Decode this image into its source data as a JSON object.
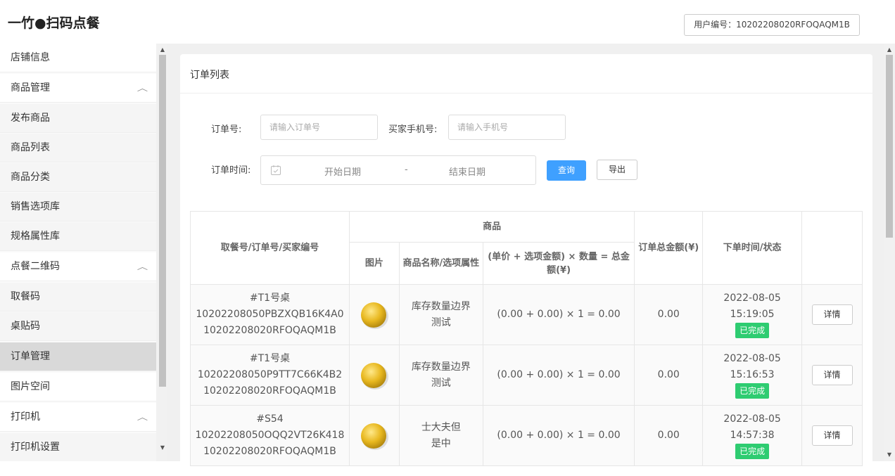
{
  "header": {
    "logo": "一竹●扫码点餐",
    "user_id": "用户编号：10202208020RFOQAQM1B"
  },
  "sidebar": {
    "items": [
      {
        "label": "店铺信息"
      },
      {
        "label": "商品管理"
      },
      {
        "label": "发布商品"
      },
      {
        "label": "商品列表"
      },
      {
        "label": "商品分类"
      },
      {
        "label": "销售选项库"
      },
      {
        "label": "规格属性库"
      },
      {
        "label": "点餐二维码"
      },
      {
        "label": "取餐码"
      },
      {
        "label": "桌贴码"
      },
      {
        "label": "订单管理"
      },
      {
        "label": "图片空间"
      },
      {
        "label": "打印机"
      },
      {
        "label": "打印机设置"
      }
    ]
  },
  "card": {
    "title": "订单列表"
  },
  "filters": {
    "order_no_label": "订单号:",
    "order_no_placeholder": "请输入订单号",
    "phone_label": "买家手机号:",
    "phone_placeholder": "请输入手机号",
    "time_label": "订单时间:",
    "start_date": "开始日期",
    "date_sep": "-",
    "end_date": "结束日期",
    "query_button": "查询",
    "export_button": "导出"
  },
  "table": {
    "headers": {
      "col1": "取餐号/订单号/买家编号",
      "goods": "商品",
      "image": "图片",
      "name": "商品名称/选项属性",
      "formula": "(单价 + 选项金额) × 数量 = 总金额(¥)",
      "total": "订单总金额(¥)",
      "time_status": "下单时间/状态"
    },
    "rows": [
      {
        "pickup": "#T1号桌",
        "order_no": "10202208050PBZXQB16K4A0",
        "buyer": "10202208020RFOQAQM1B",
        "name": "库存数量边界测试",
        "formula": "(0.00 + 0.00) × 1 = 0.00",
        "total": "0.00",
        "date": "2022-08-05",
        "time": "15:19:05",
        "status": "已完成",
        "detail": "详情"
      },
      {
        "pickup": "#T1号桌",
        "order_no": "10202208050P9TT7C66K4B2",
        "buyer": "10202208020RFOQAQM1B",
        "name": "库存数量边界测试",
        "formula": "(0.00 + 0.00) × 1 = 0.00",
        "total": "0.00",
        "date": "2022-08-05",
        "time": "15:16:53",
        "status": "已完成",
        "detail": "详情"
      },
      {
        "pickup": "#S54",
        "order_no": "10202208050OQQ2VT26K418",
        "buyer": "10202208020RFOQAQM1B",
        "name": "士大夫但是中",
        "formula": "(0.00 + 0.00) × 1 = 0.00",
        "total": "0.00",
        "date": "2022-08-05",
        "time": "14:57:38",
        "status": "已完成",
        "detail": "详情"
      }
    ]
  },
  "colors": {
    "primary": "#3fa0ff",
    "status_done": "#2ecc71",
    "active_menu": "#d9d9d9"
  }
}
